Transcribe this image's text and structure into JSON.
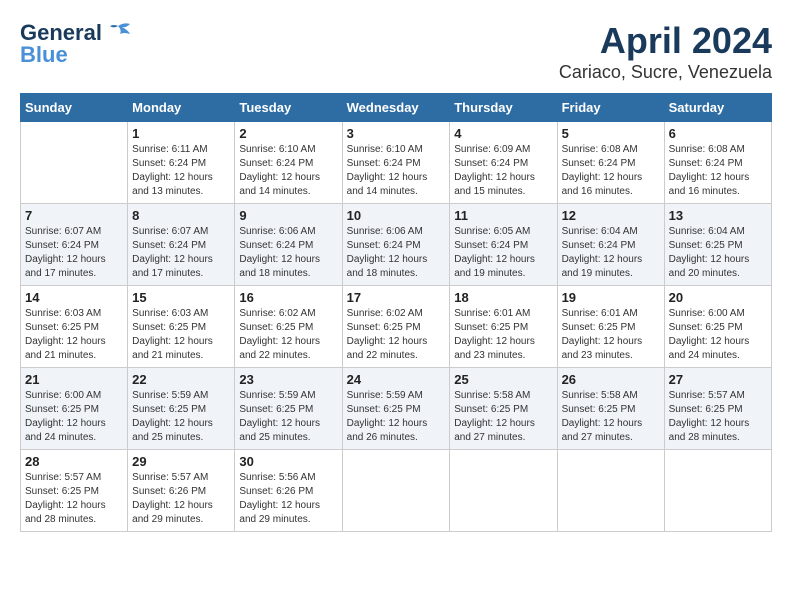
{
  "header": {
    "logo_line1": "General",
    "logo_line2": "Blue",
    "title": "April 2024",
    "subtitle": "Cariaco, Sucre, Venezuela"
  },
  "calendar": {
    "days_of_week": [
      "Sunday",
      "Monday",
      "Tuesday",
      "Wednesday",
      "Thursday",
      "Friday",
      "Saturday"
    ],
    "weeks": [
      [
        {
          "day": "",
          "info": ""
        },
        {
          "day": "1",
          "info": "Sunrise: 6:11 AM\nSunset: 6:24 PM\nDaylight: 12 hours\nand 13 minutes."
        },
        {
          "day": "2",
          "info": "Sunrise: 6:10 AM\nSunset: 6:24 PM\nDaylight: 12 hours\nand 14 minutes."
        },
        {
          "day": "3",
          "info": "Sunrise: 6:10 AM\nSunset: 6:24 PM\nDaylight: 12 hours\nand 14 minutes."
        },
        {
          "day": "4",
          "info": "Sunrise: 6:09 AM\nSunset: 6:24 PM\nDaylight: 12 hours\nand 15 minutes."
        },
        {
          "day": "5",
          "info": "Sunrise: 6:08 AM\nSunset: 6:24 PM\nDaylight: 12 hours\nand 16 minutes."
        },
        {
          "day": "6",
          "info": "Sunrise: 6:08 AM\nSunset: 6:24 PM\nDaylight: 12 hours\nand 16 minutes."
        }
      ],
      [
        {
          "day": "7",
          "info": "Sunrise: 6:07 AM\nSunset: 6:24 PM\nDaylight: 12 hours\nand 17 minutes."
        },
        {
          "day": "8",
          "info": "Sunrise: 6:07 AM\nSunset: 6:24 PM\nDaylight: 12 hours\nand 17 minutes."
        },
        {
          "day": "9",
          "info": "Sunrise: 6:06 AM\nSunset: 6:24 PM\nDaylight: 12 hours\nand 18 minutes."
        },
        {
          "day": "10",
          "info": "Sunrise: 6:06 AM\nSunset: 6:24 PM\nDaylight: 12 hours\nand 18 minutes."
        },
        {
          "day": "11",
          "info": "Sunrise: 6:05 AM\nSunset: 6:24 PM\nDaylight: 12 hours\nand 19 minutes."
        },
        {
          "day": "12",
          "info": "Sunrise: 6:04 AM\nSunset: 6:24 PM\nDaylight: 12 hours\nand 19 minutes."
        },
        {
          "day": "13",
          "info": "Sunrise: 6:04 AM\nSunset: 6:25 PM\nDaylight: 12 hours\nand 20 minutes."
        }
      ],
      [
        {
          "day": "14",
          "info": "Sunrise: 6:03 AM\nSunset: 6:25 PM\nDaylight: 12 hours\nand 21 minutes."
        },
        {
          "day": "15",
          "info": "Sunrise: 6:03 AM\nSunset: 6:25 PM\nDaylight: 12 hours\nand 21 minutes."
        },
        {
          "day": "16",
          "info": "Sunrise: 6:02 AM\nSunset: 6:25 PM\nDaylight: 12 hours\nand 22 minutes."
        },
        {
          "day": "17",
          "info": "Sunrise: 6:02 AM\nSunset: 6:25 PM\nDaylight: 12 hours\nand 22 minutes."
        },
        {
          "day": "18",
          "info": "Sunrise: 6:01 AM\nSunset: 6:25 PM\nDaylight: 12 hours\nand 23 minutes."
        },
        {
          "day": "19",
          "info": "Sunrise: 6:01 AM\nSunset: 6:25 PM\nDaylight: 12 hours\nand 23 minutes."
        },
        {
          "day": "20",
          "info": "Sunrise: 6:00 AM\nSunset: 6:25 PM\nDaylight: 12 hours\nand 24 minutes."
        }
      ],
      [
        {
          "day": "21",
          "info": "Sunrise: 6:00 AM\nSunset: 6:25 PM\nDaylight: 12 hours\nand 24 minutes."
        },
        {
          "day": "22",
          "info": "Sunrise: 5:59 AM\nSunset: 6:25 PM\nDaylight: 12 hours\nand 25 minutes."
        },
        {
          "day": "23",
          "info": "Sunrise: 5:59 AM\nSunset: 6:25 PM\nDaylight: 12 hours\nand 25 minutes."
        },
        {
          "day": "24",
          "info": "Sunrise: 5:59 AM\nSunset: 6:25 PM\nDaylight: 12 hours\nand 26 minutes."
        },
        {
          "day": "25",
          "info": "Sunrise: 5:58 AM\nSunset: 6:25 PM\nDaylight: 12 hours\nand 27 minutes."
        },
        {
          "day": "26",
          "info": "Sunrise: 5:58 AM\nSunset: 6:25 PM\nDaylight: 12 hours\nand 27 minutes."
        },
        {
          "day": "27",
          "info": "Sunrise: 5:57 AM\nSunset: 6:25 PM\nDaylight: 12 hours\nand 28 minutes."
        }
      ],
      [
        {
          "day": "28",
          "info": "Sunrise: 5:57 AM\nSunset: 6:25 PM\nDaylight: 12 hours\nand 28 minutes."
        },
        {
          "day": "29",
          "info": "Sunrise: 5:57 AM\nSunset: 6:26 PM\nDaylight: 12 hours\nand 29 minutes."
        },
        {
          "day": "30",
          "info": "Sunrise: 5:56 AM\nSunset: 6:26 PM\nDaylight: 12 hours\nand 29 minutes."
        },
        {
          "day": "",
          "info": ""
        },
        {
          "day": "",
          "info": ""
        },
        {
          "day": "",
          "info": ""
        },
        {
          "day": "",
          "info": ""
        }
      ]
    ]
  }
}
